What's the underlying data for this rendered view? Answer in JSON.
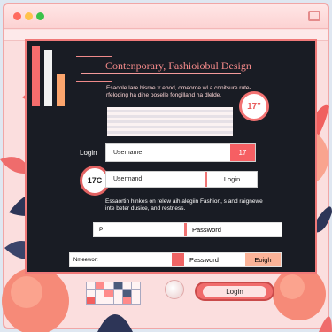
{
  "window": {
    "title_text": "",
    "colors": {
      "accent": "#f06c6c",
      "panel": "#191c24",
      "window_bg": "#fbdede"
    }
  },
  "header": {
    "title": "Contenporary, Fashioiobul Design",
    "description": "Esaonle lare hisrne tr ebod, omeorde wl a cnnitsure rute-rfeloding ha dine poselle fongilland ha dlelde."
  },
  "badge_17": "17\"",
  "login_label": "Login",
  "form": {
    "username_label": "Username",
    "username_value": "17",
    "usermand_label": "Usermand",
    "login_button_inline": "Login",
    "circle_badge": "17C",
    "note": "Essaortin hinkes on relew aih alegiin Fashion, s and raignewe inte beter dusice, and restness.",
    "password_left_value": "P",
    "password_label": "Password",
    "password2_left_label": "Nmeewort",
    "password2_label": "Password",
    "password2_action": "Eoigh"
  },
  "footer": {
    "login_button": "Login"
  },
  "icons": [
    "close-dot-icon",
    "minimize-dot-icon",
    "maximize-dot-icon",
    "window-icon"
  ]
}
